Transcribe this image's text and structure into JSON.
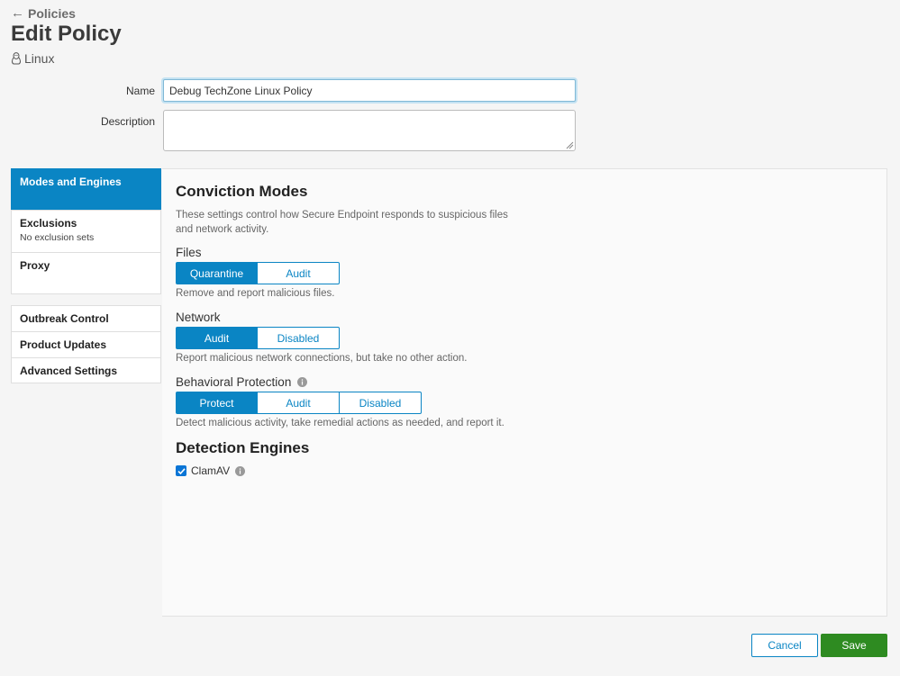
{
  "header": {
    "back_label": "Policies",
    "title": "Edit Policy",
    "platform": "Linux"
  },
  "form": {
    "name_label": "Name",
    "name_value": "Debug TechZone Linux Policy",
    "description_label": "Description",
    "description_value": ""
  },
  "sidebar": {
    "group1": [
      {
        "label": "Modes and Engines",
        "sub": "",
        "active": true
      },
      {
        "label": "Exclusions",
        "sub": "No exclusion sets",
        "active": false
      },
      {
        "label": "Proxy",
        "sub": "",
        "active": false
      }
    ],
    "group2": [
      {
        "label": "Outbreak Control"
      },
      {
        "label": "Product Updates"
      },
      {
        "label": "Advanced Settings"
      }
    ]
  },
  "main": {
    "conviction_title": "Conviction Modes",
    "intro": "These settings control how Secure Endpoint responds to suspicious files and network activity.",
    "files": {
      "label": "Files",
      "options": [
        "Quarantine",
        "Audit"
      ],
      "selected": "Quarantine",
      "help": "Remove and report malicious files."
    },
    "network": {
      "label": "Network",
      "options": [
        "Audit",
        "Disabled"
      ],
      "selected": "Audit",
      "help": "Report malicious network connections, but take no other action."
    },
    "behavioral": {
      "label": "Behavioral Protection",
      "options": [
        "Protect",
        "Audit",
        "Disabled"
      ],
      "selected": "Protect",
      "help": "Detect malicious activity, take remedial actions as needed, and report it."
    },
    "detection_title": "Detection Engines",
    "clamav": {
      "label": "ClamAV",
      "checked": true
    }
  },
  "footer": {
    "cancel_label": "Cancel",
    "save_label": "Save"
  },
  "colors": {
    "accent": "#0a85c4",
    "save": "#2e8b21"
  }
}
